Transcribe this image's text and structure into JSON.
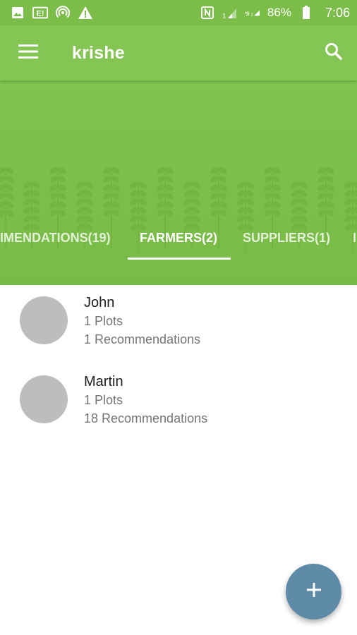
{
  "status_bar": {
    "icons_left": [
      "image-icon",
      "e-ticket-icon",
      "hotspot-icon",
      "warning-icon"
    ],
    "icons_right": [
      "nfc-icon",
      "signal-1-icon",
      "signal-2-icon"
    ],
    "battery": "86%",
    "time": "7:06"
  },
  "toolbar": {
    "title": "krishe",
    "menu_icon": "hamburger-menu-icon",
    "search_icon": "search-icon"
  },
  "tabs": [
    {
      "label": "IMENDATIONS(19)",
      "active": false
    },
    {
      "label": "FARMERS(2)",
      "active": true
    },
    {
      "label": "SUPPLIERS(1)",
      "active": false
    },
    {
      "label": "I",
      "active": false
    }
  ],
  "farmers": [
    {
      "name": "John",
      "plots": "1 Plots",
      "recommendations": "1 Recommendations"
    },
    {
      "name": "Martin",
      "plots": "1 Plots",
      "recommendations": "18 Recommendations"
    }
  ],
  "fab": {
    "icon": "add-icon",
    "label": "+"
  },
  "colors": {
    "primary": "#84c553",
    "status_bar": "#7cbd4a",
    "fab": "#5d8aa6",
    "avatar": "#bdbdbd"
  }
}
